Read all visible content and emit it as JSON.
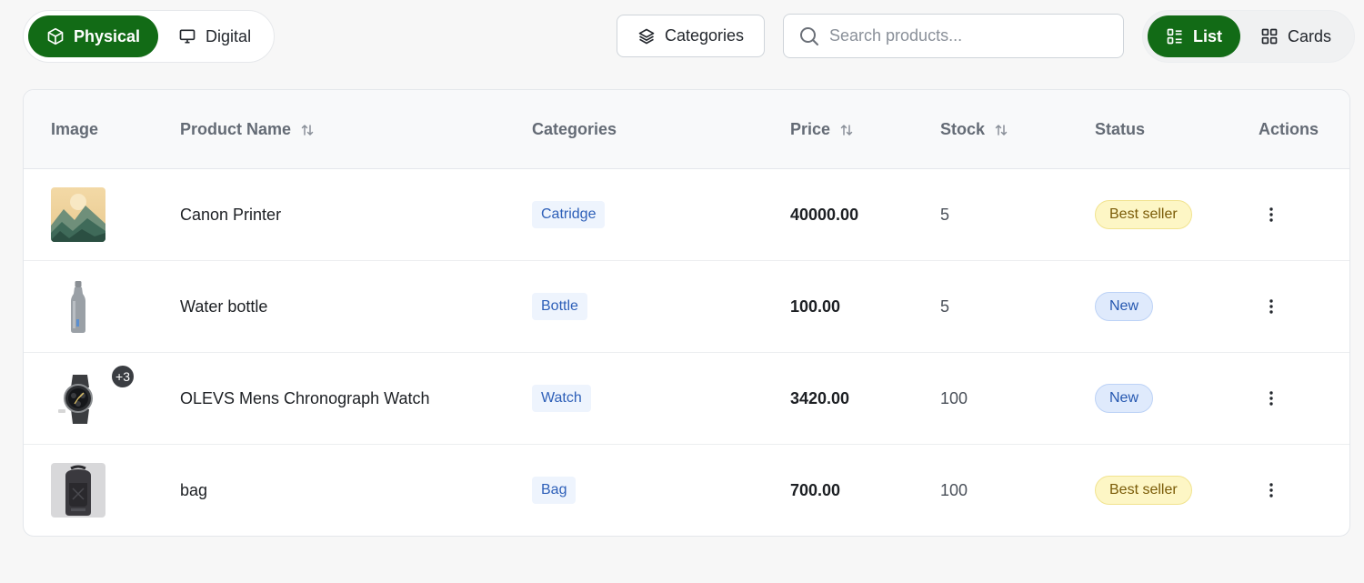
{
  "product_type_toggle": {
    "physical_label": "Physical",
    "digital_label": "Digital",
    "active": "Physical"
  },
  "categories_button_label": "Categories",
  "search": {
    "placeholder": "Search products...",
    "value": ""
  },
  "view_toggle": {
    "list_label": "List",
    "cards_label": "Cards",
    "active": "List"
  },
  "table": {
    "headers": {
      "image": "Image",
      "product_name": "Product Name",
      "categories": "Categories",
      "price": "Price",
      "stock": "Stock",
      "status": "Status",
      "actions": "Actions"
    },
    "rows": [
      {
        "image": "mountain-landscape-image",
        "name": "Canon Printer",
        "category": "Catridge",
        "price": "40000.00",
        "stock": "5",
        "status": "Best seller",
        "extra_images": ""
      },
      {
        "image": "water-bottle-image",
        "name": "Water bottle",
        "category": "Bottle",
        "price": "100.00",
        "stock": "5",
        "status": "New",
        "extra_images": ""
      },
      {
        "image": "watch-image",
        "name": "OLEVS Mens Chronograph Watch",
        "category": "Watch",
        "price": "3420.00",
        "stock": "100",
        "status": "New",
        "extra_images": "+3"
      },
      {
        "image": "backpack-image",
        "name": "bag",
        "category": "Bag",
        "price": "700.00",
        "stock": "100",
        "status": "Best seller",
        "extra_images": ""
      }
    ]
  },
  "colors": {
    "accent": "#126b16",
    "best_seller_bg": "#fdf6c5",
    "new_bg": "#dfeafc",
    "category_bg": "#eef4fd"
  }
}
